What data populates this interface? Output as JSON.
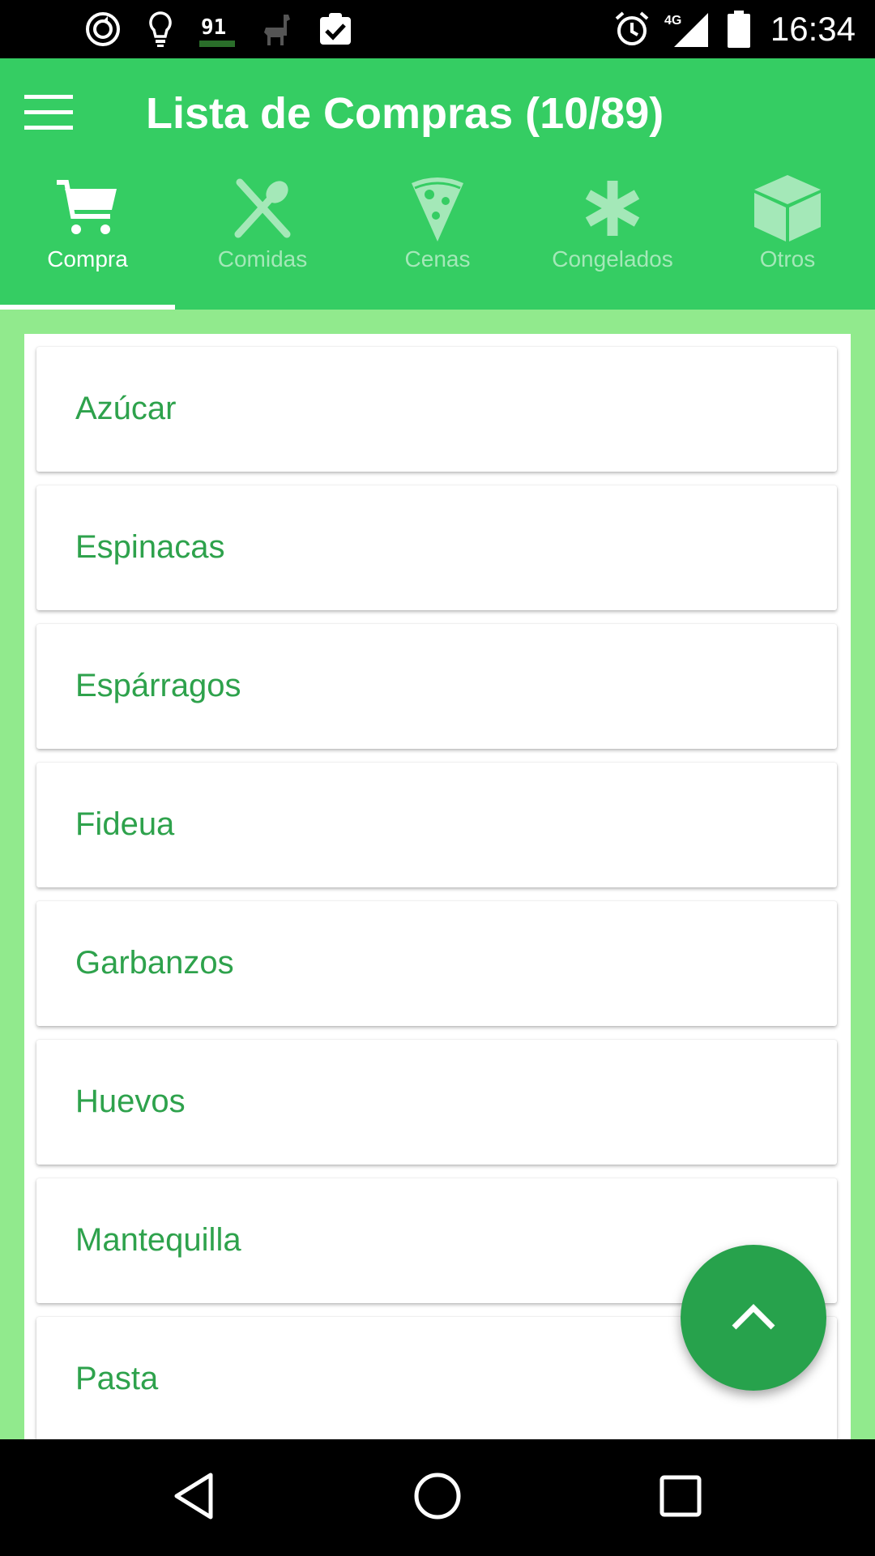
{
  "status_bar": {
    "time": "16:34",
    "network": "4G",
    "icons": [
      "sync-icon",
      "lightbulb-icon",
      "widget-91-icon",
      "llama-icon",
      "clipboard-check-icon",
      "alarm-icon",
      "signal-icon",
      "battery-icon"
    ]
  },
  "app_bar": {
    "title": "Lista de Compras (10/89)",
    "accent_color": "#35cd63"
  },
  "tabs": [
    {
      "label": "Compra",
      "icon": "cart-icon",
      "active": true
    },
    {
      "label": "Comidas",
      "icon": "fork-spoon-icon",
      "active": false
    },
    {
      "label": "Cenas",
      "icon": "pizza-icon",
      "active": false
    },
    {
      "label": "Congelados",
      "icon": "asterisk-icon",
      "active": false
    },
    {
      "label": "Otros",
      "icon": "box-icon",
      "active": false
    }
  ],
  "list": {
    "item_color": "#2ea24c",
    "items": [
      {
        "label": "Azúcar"
      },
      {
        "label": "Espinacas"
      },
      {
        "label": "Espárragos"
      },
      {
        "label": "Fideua"
      },
      {
        "label": "Garbanzos"
      },
      {
        "label": "Huevos"
      },
      {
        "label": "Mantequilla"
      },
      {
        "label": "Pasta"
      }
    ]
  },
  "fab": {
    "icon": "chevron-up-icon",
    "color": "#27a24c"
  },
  "nav_bar": {
    "icons": [
      "back-icon",
      "home-icon",
      "recents-icon"
    ]
  }
}
